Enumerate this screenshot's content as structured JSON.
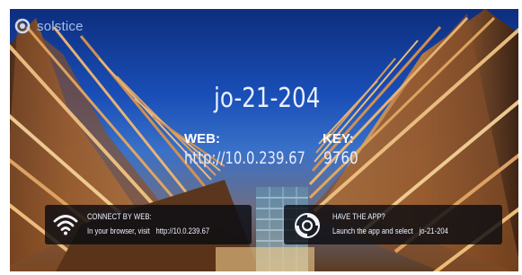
{
  "brand": {
    "name": "solstice",
    "logo_icon": "solstice-ring-icon"
  },
  "room": {
    "name": "jo-21-204"
  },
  "web": {
    "label": "WEB:",
    "value": "http://10.0.239.67"
  },
  "key": {
    "label": "KEY:",
    "value": "9760"
  },
  "cards": {
    "connect_web": {
      "icon": "wifi-icon",
      "title": "CONNECT BY WEB:",
      "text_prefix": "In your browser, visit",
      "text_value": "http://10.0.239.67"
    },
    "have_app": {
      "icon": "solstice-app-icon",
      "title": "HAVE THE APP?",
      "text_prefix": "Launch the app and select",
      "text_value": "jo-21-204"
    }
  },
  "colors": {
    "sky_top": "#0c2a78",
    "sky_mid": "#3a71c8",
    "wood": "#c98a4a",
    "card_bg": "#0a0c12"
  }
}
